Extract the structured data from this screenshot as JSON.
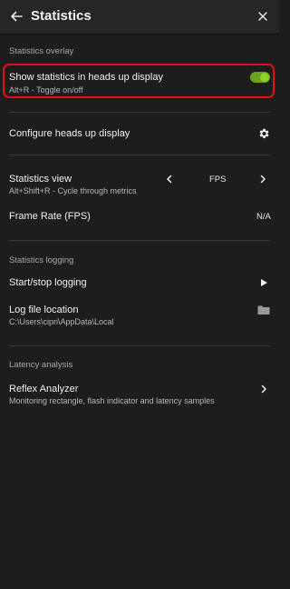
{
  "header": {
    "title": "Statistics",
    "back_icon": "arrow-left-icon",
    "close_icon": "close-icon"
  },
  "overlay_section": {
    "label": "Statistics overlay",
    "hud_toggle": {
      "title": "Show statistics in heads up display",
      "subtitle": "Alt+R - Toggle on/off",
      "state": "on",
      "accent_color": "#76b900"
    },
    "configure": {
      "title": "Configure heads up display",
      "icon": "gear-icon"
    },
    "statistics_view": {
      "title": "Statistics view",
      "subtitle": "Alt+Shift+R - Cycle through metrics",
      "value": "FPS"
    },
    "frame_rate": {
      "title": "Frame Rate (FPS)",
      "value": "N/A"
    }
  },
  "logging_section": {
    "label": "Statistics logging",
    "start_stop": {
      "title": "Start/stop logging",
      "icon": "play-icon"
    },
    "log_location": {
      "title": "Log file location",
      "path": "C:\\Users\\cipri\\AppData\\Local",
      "icon": "folder-icon"
    }
  },
  "latency_section": {
    "label": "Latency analysis",
    "reflex": {
      "title": "Reflex Analyzer",
      "subtitle": "Monitoring rectangle, flash indicator and latency samples",
      "icon": "chevron-right-icon"
    }
  },
  "colors": {
    "highlight_border": "#e0101a",
    "background": "#1d1d1d"
  }
}
